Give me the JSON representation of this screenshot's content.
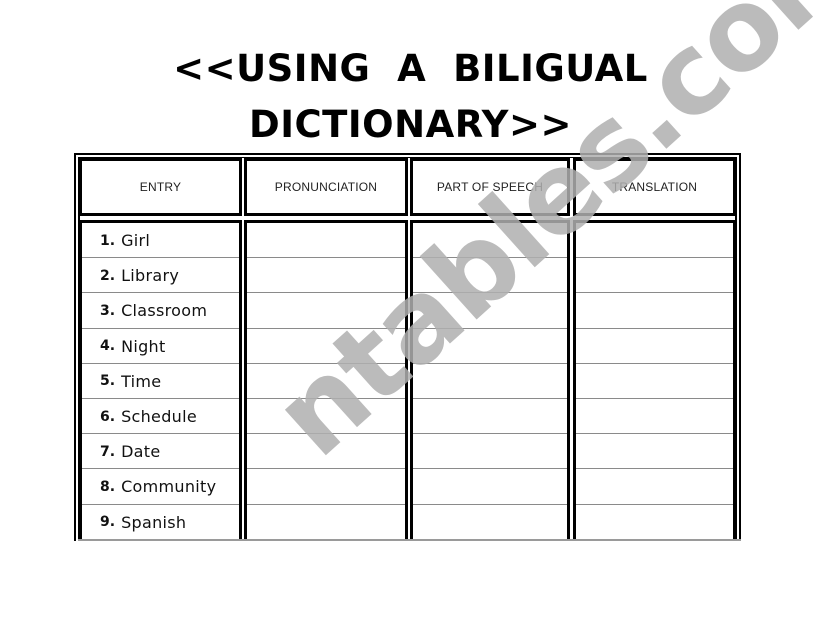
{
  "document": {
    "title_line1": "<<USING  A  BILIGUAL",
    "title_line2": "DICTIONARY>>"
  },
  "table": {
    "headers": [
      "ENTRY",
      "PRONUNCIATION",
      "PART OF SPEECH",
      "TRANSLATION"
    ],
    "rows": [
      {
        "num": "1.",
        "word": "Girl",
        "pronunciation": "",
        "part_of_speech": "",
        "translation": ""
      },
      {
        "num": "2.",
        "word": "Library",
        "pronunciation": "",
        "part_of_speech": "",
        "translation": ""
      },
      {
        "num": "3.",
        "word": "Classroom",
        "pronunciation": "",
        "part_of_speech": "",
        "translation": ""
      },
      {
        "num": "4.",
        "word": "Night",
        "pronunciation": "",
        "part_of_speech": "",
        "translation": ""
      },
      {
        "num": "5.",
        "word": "Time",
        "pronunciation": "",
        "part_of_speech": "",
        "translation": ""
      },
      {
        "num": "6.",
        "word": "Schedule",
        "pronunciation": "",
        "part_of_speech": "",
        "translation": ""
      },
      {
        "num": "7.",
        "word": "Date",
        "pronunciation": "",
        "part_of_speech": "",
        "translation": ""
      },
      {
        "num": "8.",
        "word": "Community",
        "pronunciation": "",
        "part_of_speech": "",
        "translation": ""
      },
      {
        "num": "9.",
        "word": "Spanish",
        "pronunciation": "",
        "part_of_speech": "",
        "translation": ""
      }
    ]
  },
  "watermark": {
    "text": "ntables.com",
    "color": "#b0b0b0"
  }
}
